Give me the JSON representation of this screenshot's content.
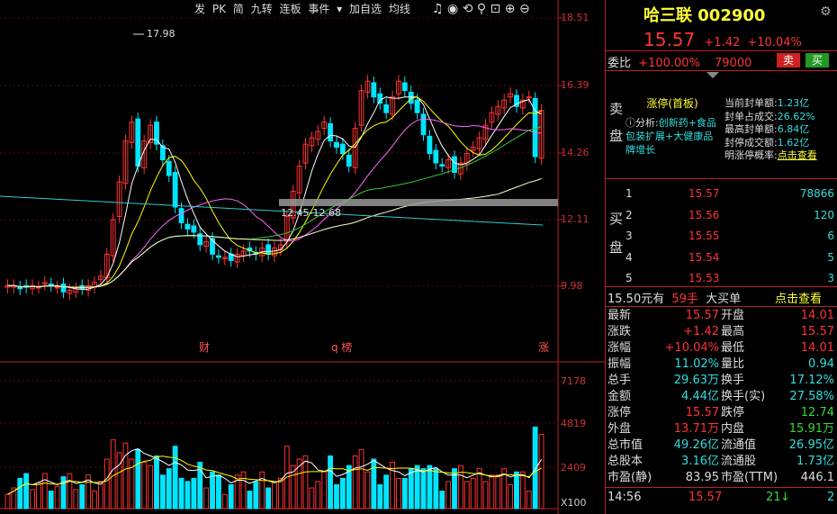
{
  "toolbar": {
    "items": [
      "发",
      "PK",
      "简",
      "九转",
      "连板",
      "事件",
      "加自选",
      "均线"
    ]
  },
  "price_axis": [
    "18.51",
    "16.39",
    "14.26",
    "12.11",
    "9.98"
  ],
  "vol_axis": [
    "7178",
    "4819",
    "2409",
    "X100"
  ],
  "annotations": {
    "high_marker": "17.98",
    "zone_label": "12.45-12.68",
    "event1": "财",
    "event2": "q 榜",
    "event3": "涨"
  },
  "header": {
    "name": "哈三联",
    "code": "002900",
    "price": "15.57",
    "change": "+1.42",
    "pct": "+10.04%"
  },
  "weibi": {
    "label": "委比",
    "pct": "+100.00%",
    "vol": "79000",
    "sell_btn": "卖",
    "buy_btn": "买"
  },
  "limit_box": {
    "sell_label_1": "卖",
    "sell_label_2": "盘",
    "title": "涨停(首板)",
    "analysis_prefix": "分析:",
    "analysis": "创新药+食品包装扩展+大健康品牌增长",
    "stats": [
      {
        "label": "当前封单额:",
        "value": "1.23亿"
      },
      {
        "label": "封单占成交:",
        "value": "26.62%"
      },
      {
        "label": "最高封单额:",
        "value": "6.84亿"
      },
      {
        "label": "封停成交额:",
        "value": "1.62亿"
      }
    ],
    "prob_label": "明涨停概率:",
    "prob_link": "点击查看"
  },
  "buy_book": {
    "label_1": "买",
    "label_2": "盘",
    "rows": [
      {
        "lvl": "1",
        "price": "15.57",
        "vol": "78866"
      },
      {
        "lvl": "2",
        "price": "15.56",
        "vol": "120"
      },
      {
        "lvl": "3",
        "price": "15.55",
        "vol": "6"
      },
      {
        "lvl": "4",
        "price": "15.54",
        "vol": "5"
      },
      {
        "lvl": "5",
        "price": "15.53",
        "vol": "3"
      }
    ]
  },
  "bigorder": {
    "price": "15.50",
    "you": "元有",
    "hands": "59手",
    "desc": "大买单",
    "link": "点击查看"
  },
  "quote": [
    {
      "l1": "最新",
      "v1": "15.57",
      "c1": "red",
      "l2": "开盘",
      "v2": "14.01",
      "c2": "red"
    },
    {
      "l1": "涨跌",
      "v1": "+1.42",
      "c1": "red",
      "l2": "最高",
      "v2": "15.57",
      "c2": "red"
    },
    {
      "l1": "涨幅",
      "v1": "+10.04%",
      "c1": "red",
      "l2": "最低",
      "v2": "14.01",
      "c2": "red"
    },
    {
      "l1": "振幅",
      "v1": "11.02%",
      "c1": "cyan",
      "l2": "量比",
      "v2": "0.94",
      "c2": "cyan"
    },
    {
      "l1": "总手",
      "v1": "29.63万",
      "c1": "cyan",
      "l2": "换手",
      "v2": "17.12%",
      "c2": "cyan"
    },
    {
      "l1": "金额",
      "v1": "4.44亿",
      "c1": "cyan",
      "l2": "换手(实)",
      "v2": "27.58%",
      "c2": "cyan"
    },
    {
      "l1": "涨停",
      "v1": "15.57",
      "c1": "red",
      "l2": "跌停",
      "v2": "12.74",
      "c2": "green"
    },
    {
      "l1": "外盘",
      "v1": "13.71万",
      "c1": "red",
      "l2": "内盘",
      "v2": "15.91万",
      "c2": "green"
    },
    {
      "l1": "总市值",
      "v1": "49.26亿",
      "c1": "cyan",
      "l2": "流通值",
      "v2": "26.95亿",
      "c2": "cyan"
    },
    {
      "l1": "总股本",
      "v1": "3.16亿",
      "c1": "cyan",
      "l2": "流通股",
      "v2": "1.73亿",
      "c2": "cyan"
    },
    {
      "l1": "市盈(静)",
      "v1": "83.95",
      "c1": "wht",
      "l2": "市盈(TTM)",
      "v2": "446.1",
      "c2": "wht"
    }
  ],
  "tick": {
    "time": "14:56",
    "price": "15.57",
    "vol": "21",
    "arrow": "↓",
    "count": "2"
  },
  "colors": {
    "up": "#ff3333",
    "down": "#00e5ff",
    "ma5": "#ffffff",
    "ma10": "#ffff00",
    "ma20": "#ff66ff",
    "ma60": "#33cc33",
    "ma120": "#ffffcc"
  }
}
